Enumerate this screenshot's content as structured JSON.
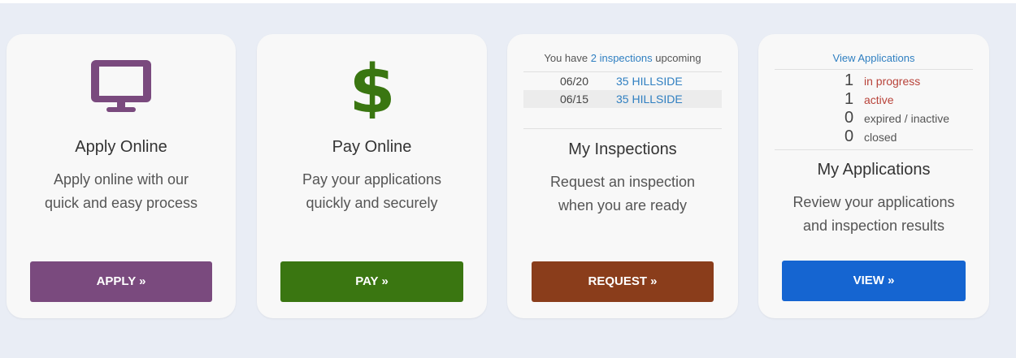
{
  "cards": [
    {
      "title": "Apply Online",
      "desc_line1": "Apply online with our",
      "desc_line2": "quick and easy process",
      "button": "APPLY »",
      "icon": "monitor-icon",
      "color": "#7a4a7e"
    },
    {
      "title": "Pay Online",
      "desc_line1": "Pay your applications",
      "desc_line2": "quickly and securely",
      "button": "PAY »",
      "icon": "dollar-icon",
      "color": "#3a7611"
    },
    {
      "title": "My Inspections",
      "desc_line1": "Request an inspection",
      "desc_line2": "when you are ready",
      "button": "REQUEST »",
      "color": "#8a3d1b",
      "upcoming_prefix": "You have",
      "upcoming_count": "2 inspections",
      "upcoming_suffix": "upcoming",
      "inspections": [
        {
          "date": "06/20",
          "address": "35 HILLSIDE"
        },
        {
          "date": "06/15",
          "address": "35 HILLSIDE"
        }
      ]
    },
    {
      "title": "My Applications",
      "desc_line1": "Review your applications",
      "desc_line2": "and inspection results",
      "button": "VIEW »",
      "color": "#1565d1",
      "view_link": "View Applications",
      "stats": [
        {
          "num": "1",
          "label": "in progress"
        },
        {
          "num": "1",
          "label": "active"
        },
        {
          "num": "0",
          "label": "expired / inactive"
        },
        {
          "num": "0",
          "label": "closed"
        }
      ]
    }
  ]
}
